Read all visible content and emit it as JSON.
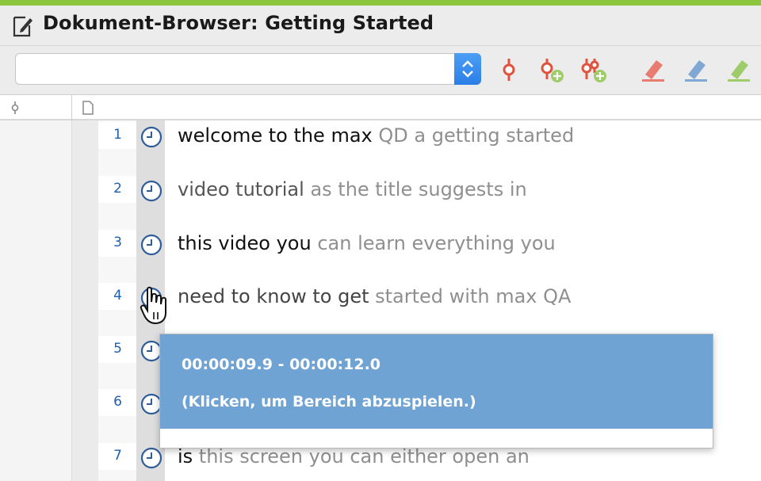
{
  "app": {
    "title": "Dokument-Browser: Getting Started"
  },
  "toolbar": {
    "combo_value": "",
    "tools": [
      {
        "name": "code-memo-icon",
        "color": "#e0533e"
      },
      {
        "name": "add-code-icon",
        "color": "#e0533e"
      },
      {
        "name": "add-subcode-icon",
        "color": "#e0533e"
      },
      {
        "name": "highlighter-red-icon",
        "color": "#e97c71"
      },
      {
        "name": "highlighter-blue-icon",
        "color": "#7fa8d4"
      },
      {
        "name": "highlighter-green-icon",
        "color": "#9fcc6a"
      }
    ]
  },
  "columns": {
    "codes_icon": "code-column-icon",
    "document_icon": "document-column-icon"
  },
  "transcript": {
    "rows": [
      {
        "line": "1",
        "dark": "welcome to the max",
        "light": " QD a getting started"
      },
      {
        "line": "2",
        "dark": "",
        "light": "",
        "lighter_mix": true,
        "text_a": "video tutorial",
        "text_b": " as the title suggests in"
      },
      {
        "line": "3",
        "dark": "this video you",
        "light": " can learn everything you"
      },
      {
        "line": "4",
        "dark": "need to know to get",
        "light": " started with max QA"
      },
      {
        "line": "5",
        "dark": "",
        "light": ""
      },
      {
        "line": "6",
        "dark": "",
        "light": ""
      },
      {
        "line": "7",
        "dark": "is",
        "light": " this screen you can either open an",
        "mid": "this screen"
      }
    ]
  },
  "tooltip": {
    "time_range": "00:00:09.9 - 00:00:12.0",
    "hint": "(Klicken, um Bereich abzuspielen.)"
  },
  "colors": {
    "accent": "#8cc63f",
    "tooltip_bg": "#6fa3d4",
    "line_number": "#1f5fb0"
  }
}
